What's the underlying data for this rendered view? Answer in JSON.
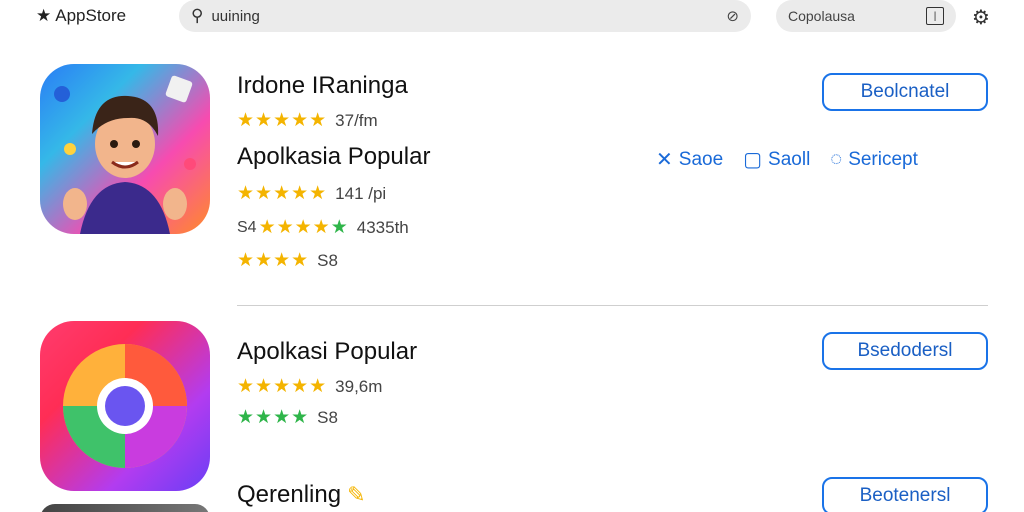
{
  "topbar": {
    "brand": "AppStore",
    "search_value": "uuining",
    "secondary_search_value": "Copolausa"
  },
  "apps": [
    {
      "title": "Irdone IRaninga",
      "rating_text": "37/fm",
      "get_label": "Beolcnatel"
    },
    {
      "title": "Apolkasia Popular",
      "rating_text": "141 /pi",
      "rating_prefix": "S4",
      "rating2_text": "4335th",
      "rating3_text": "S8"
    },
    {
      "title": "Apolkasi Popular",
      "rating_text": "39,6m",
      "rating2_text": "S8",
      "get_label": "Bsedodersl"
    },
    {
      "title": "Qerenling",
      "get_label": "Beotenersl"
    }
  ],
  "actions": [
    {
      "label": "Saoe",
      "icon": "share-icon"
    },
    {
      "label": "Saoll",
      "icon": "bookmark-icon"
    },
    {
      "label": "Sericept",
      "icon": "chat-icon"
    }
  ],
  "colors": {
    "accent": "#1a73e8",
    "star": "#f4b400",
    "star_green": "#2fb54a"
  }
}
